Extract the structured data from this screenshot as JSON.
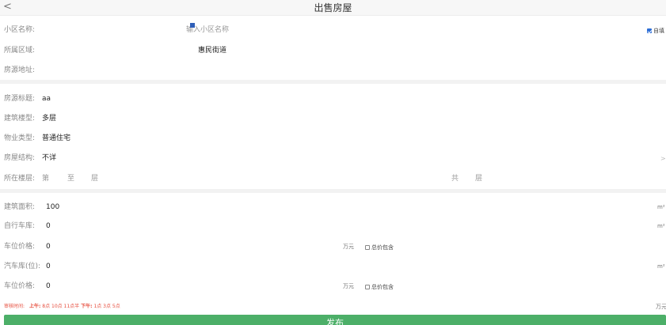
{
  "header": {
    "back_icon": "chevron-left-icon",
    "back_glyph": "<",
    "title": "出售房屋"
  },
  "community": {
    "label": "小区名称:",
    "placeholder": "输入小区名称",
    "auto_fill_label": "自填",
    "auto_fill_checked": true
  },
  "district": {
    "label": "所属区域:",
    "value": "惠民街道"
  },
  "address": {
    "label": "房源地址:",
    "value": ""
  },
  "listing": {
    "title_label": "房源标题:",
    "title_value": "aa",
    "building_type_label": "建筑楼型:",
    "building_type_value": "多层",
    "property_type_label": "物业类型:",
    "property_type_value": "普通住宅",
    "structure_label": "房屋结构:",
    "structure_value": "不详",
    "structure_arrow": ">",
    "floor_label": "所在楼层:",
    "floor_di": "第",
    "floor_to": "至",
    "floor_ceng": "层",
    "floor_total": "共",
    "floor_total_ceng": "层"
  },
  "area": {
    "building_area_label": "建筑面积:",
    "building_area_value": "100",
    "building_area_unit": "m²",
    "bike_garage_label": "自行车库:",
    "bike_garage_value": "0",
    "bike_garage_unit": "m²",
    "parking_price_label": "车位价格:",
    "parking_price_value": "0",
    "parking_price_unit": "万元",
    "parking_included_label": "总价包含",
    "parking_included_checked": false,
    "car_garage_label": "汽车库(位):",
    "car_garage_value": "0",
    "car_garage_unit": "m²",
    "parking_price2_label": "车位价格:",
    "parking_price2_value": "0",
    "parking_price2_unit": "万元",
    "parking_included2_label": "总价包含",
    "parking_included2_checked": false
  },
  "review_note": {
    "prefix": "审核时间:",
    "morning_label": "上午:",
    "morning_times": "8点 10点 11点半",
    "afternoon_label": "下午:",
    "afternoon_times": "1点 3点 5点"
  },
  "total_price_unit": "万元",
  "publish_label": "发布",
  "colors": {
    "accent_green": "#4caf68",
    "note_red": "#e64b3b",
    "checkbox_blue": "#2f6fd6"
  }
}
